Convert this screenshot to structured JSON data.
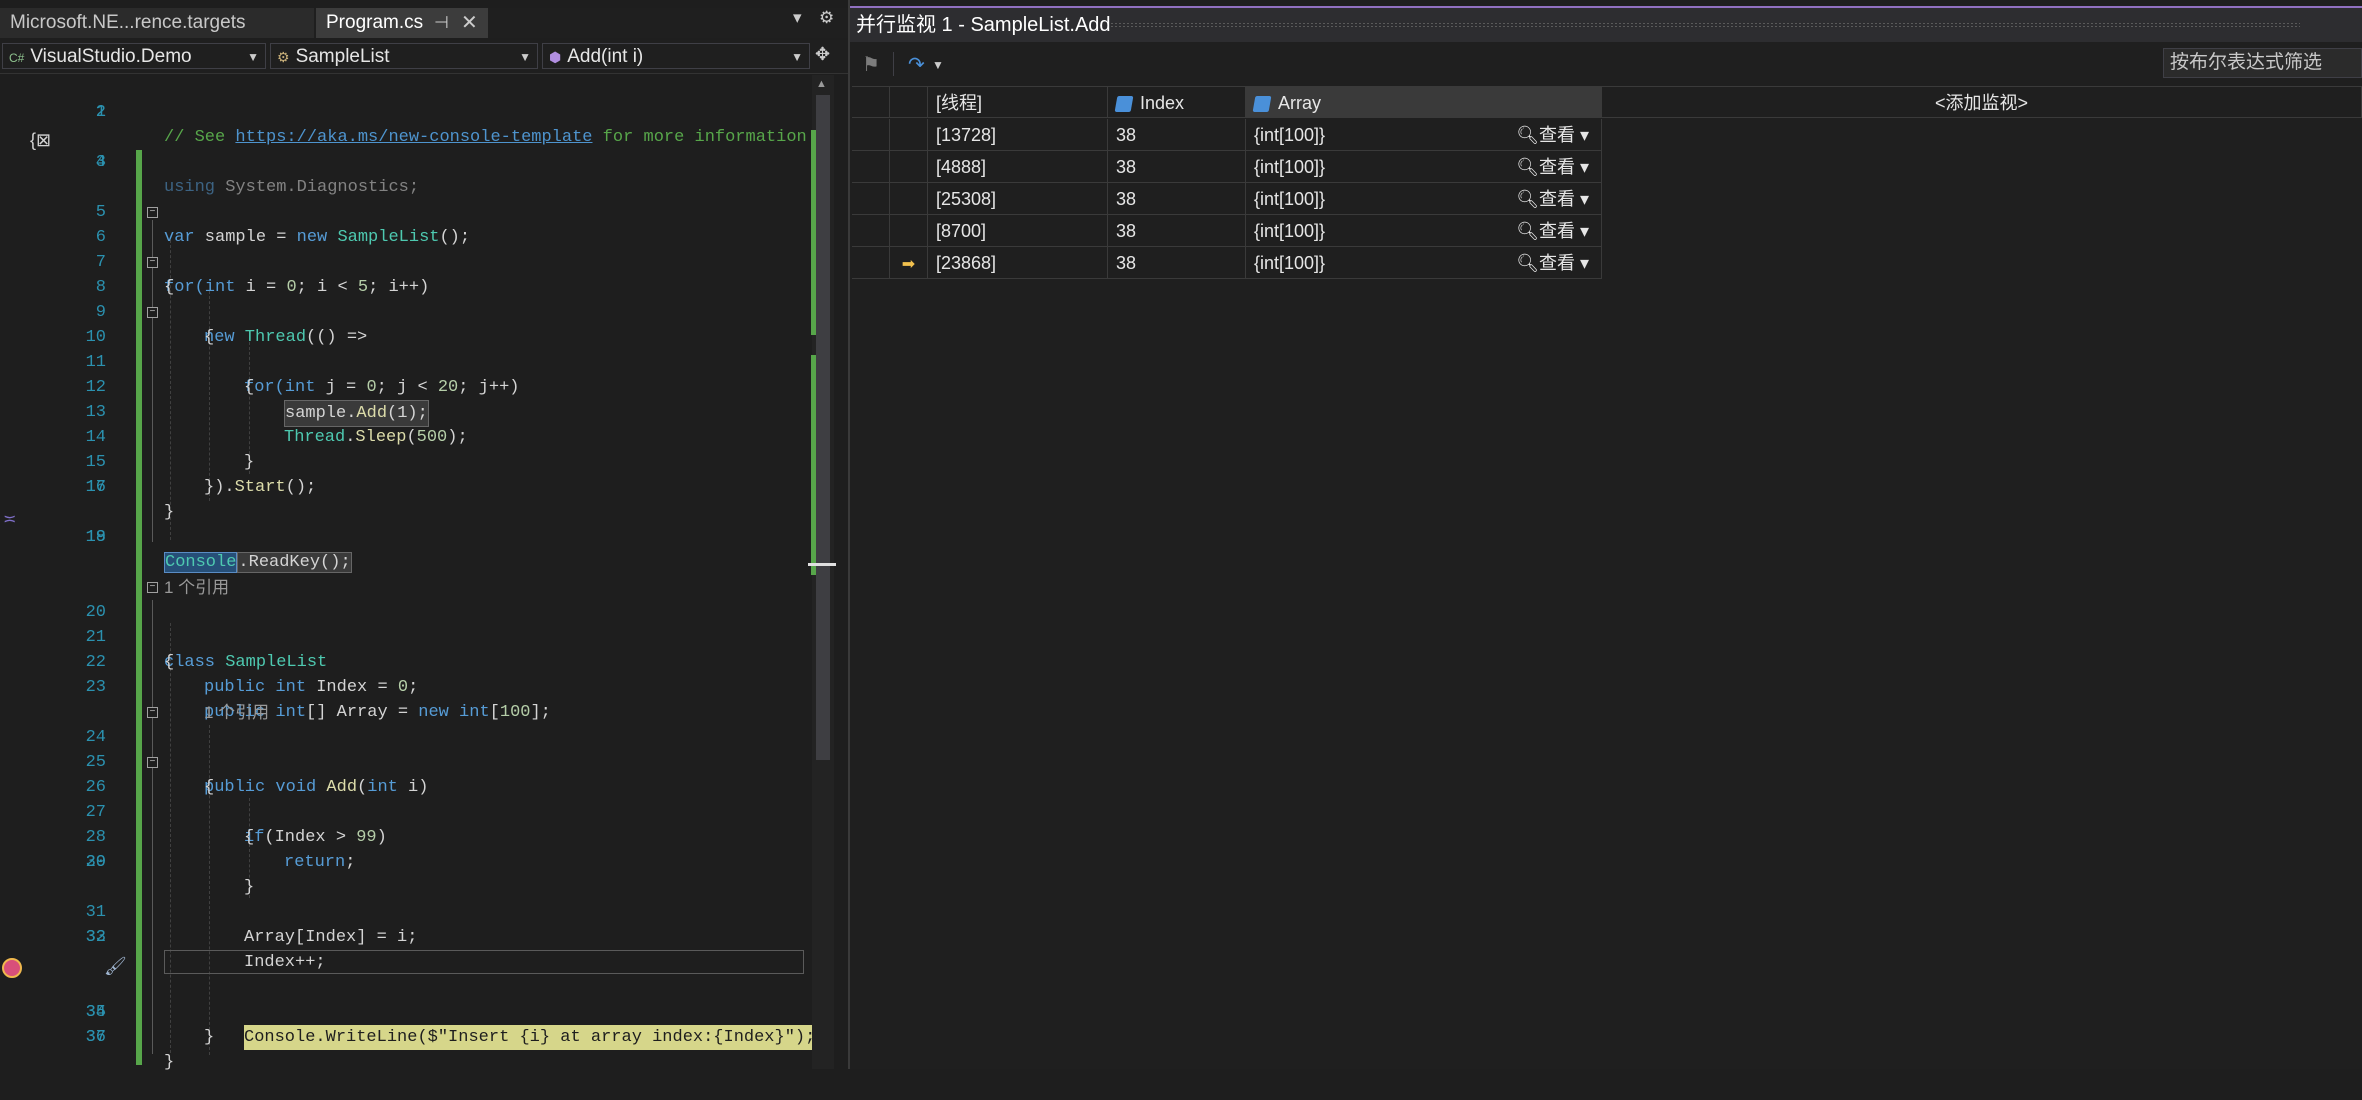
{
  "editor": {
    "tabs": [
      {
        "label": "Microsoft.NE...rence.targets"
      },
      {
        "label": "Program.cs",
        "pin_glyph": "⊣",
        "close_glyph": "✕"
      }
    ],
    "tab_tools": {
      "dropdown": "▾",
      "settings": "⚙"
    },
    "nav": {
      "project": "VisualStudio.Demo",
      "project_icon": "C#",
      "type": "SampleList",
      "member": "Add(int i)"
    },
    "line_numbers": [
      "1",
      "2",
      "3",
      "4",
      "5",
      "6",
      "7",
      "8",
      "9",
      "10",
      "11",
      "12",
      "13",
      "14",
      "15",
      "16",
      "17",
      "18",
      "19",
      "20",
      "21",
      "22",
      "23",
      "24",
      "25",
      "26",
      "27",
      "28",
      "29",
      "30",
      "31",
      "32",
      "33",
      "34",
      "35",
      "36",
      "37"
    ],
    "code_lens_text": "1 个引用",
    "code": {
      "l1_comment": "// See ",
      "l1_link": "https://aka.ms/new-console-template",
      "l1_tail": " for more information",
      "l3_using": "using",
      "l3_ns": " System.Diagnostics;",
      "l5_var": "var",
      "l5_name": " sample = ",
      "l5_new": "new",
      "l5_type": " SampleList",
      "l5_tail": "();",
      "l6_for": "for",
      "l6_int": "(int",
      "l6_a": " i = ",
      "l6_n0": "0",
      "l6_b": "; i < ",
      "l6_n5": "5",
      "l6_c": "; i++)",
      "brace_open": "{",
      "brace_close": "}",
      "l8_new": "new",
      "l8_type": " Thread",
      "l8_tail": "(() =>",
      "l10_for": "for",
      "l10_int": "(int",
      "l10_a": " j = ",
      "l10_n0": "0",
      "l10_b": "; j < ",
      "l10_n20": "20",
      "l10_c": "; j++)",
      "l12_obj": "sample",
      "l12_dot": ".",
      "l12_fn": "Add",
      "l12_args": "(1);",
      "l13_type": "Thread",
      "l13_dot": ".",
      "l13_fn": "Sleep",
      "l13_open": "(",
      "l13_num": "500",
      "l13_close": ");",
      "l15_a": "}).",
      "l15_fn": "Start",
      "l15_b": "();",
      "l18_console": "Console",
      "l18_rest": ".ReadKey();",
      "l20_class": "class",
      "l20_name": " SampleList",
      "l22_pub": "public",
      "l22_int": " int",
      "l22_rest": " Index = ",
      "l22_num": "0",
      "l22_end": ";",
      "l23_pub": "public",
      "l23_int": " int",
      "l23_a": "[] Array = ",
      "l23_new": "new",
      "l23_int2": " int",
      "l23_b": "[",
      "l23_num": "100",
      "l23_c": "];",
      "l24_pub": "public",
      "l24_void": " void",
      "l24_fn": " Add",
      "l24_open": "(",
      "l24_int": "int",
      "l24_close": " i)",
      "l26_if": "if",
      "l26_a": "(Index > ",
      "l26_num": "99",
      "l26_b": ")",
      "l28_ret": "return",
      "l28_end": ";",
      "l31": "Array[Index] = i;",
      "l32": "Index++;",
      "l34_type": "Console",
      "l34_dot": ".",
      "l34_fn": "WriteLine",
      "l34_str": "($\"Insert {i} at array index:{Index}\");"
    }
  },
  "parallel_watch": {
    "title": "并行监视 1 - SampleList.Add",
    "filter_placeholder": "按布尔表达式筛选",
    "columns": {
      "thread": "[线程]",
      "index": "Index",
      "array": "Array",
      "add_watch": "<添加监视>"
    },
    "view_label": "查看",
    "rows": [
      {
        "thread": "[13728]",
        "index": "38",
        "array": "{int[100]}",
        "current": false
      },
      {
        "thread": "[4888]",
        "index": "38",
        "array": "{int[100]}",
        "current": false
      },
      {
        "thread": "[25308]",
        "index": "38",
        "array": "{int[100]}",
        "current": false
      },
      {
        "thread": "[8700]",
        "index": "38",
        "array": "{int[100]}",
        "current": false
      },
      {
        "thread": "[23868]",
        "index": "38",
        "array": "{int[100]}",
        "current": true
      }
    ]
  }
}
